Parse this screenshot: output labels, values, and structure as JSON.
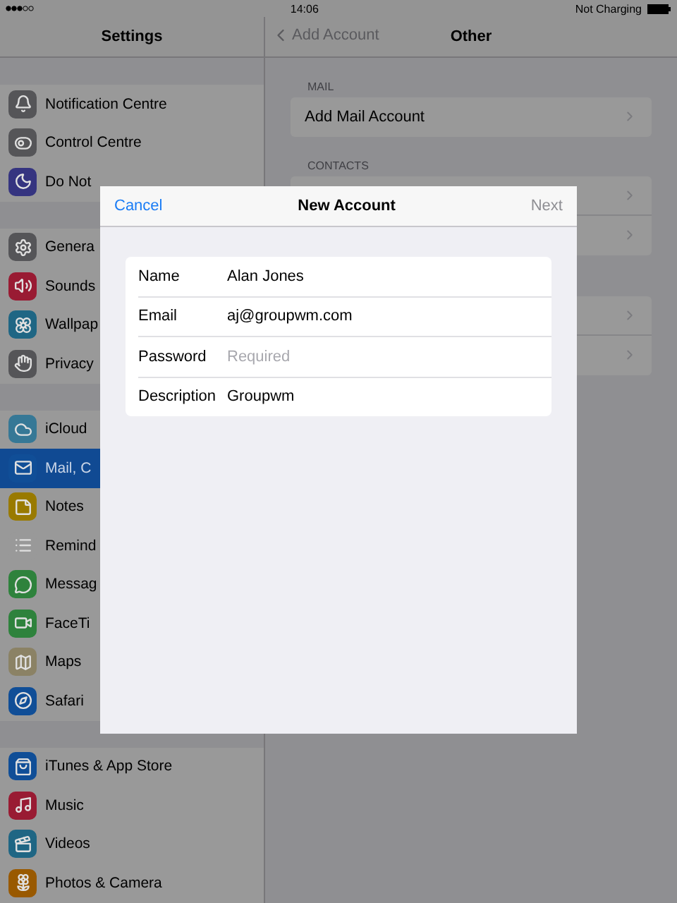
{
  "status_bar": {
    "time": "14:06",
    "charging": "Not Charging"
  },
  "sidebar": {
    "title": "Settings",
    "groups": [
      {
        "items": [
          {
            "label": "Notification Centre",
            "color": "#555558",
            "selected": false
          },
          {
            "label": "Control Centre",
            "color": "#555558",
            "selected": false
          },
          {
            "label": "Do Not",
            "color": "#353480",
            "selected": false
          }
        ]
      },
      {
        "items": [
          {
            "label": "Genera",
            "color": "#555558",
            "selected": false
          },
          {
            "label": "Sounds",
            "color": "#991b33",
            "selected": false
          },
          {
            "label": "Wallpap",
            "color": "#1f6684",
            "selected": false
          },
          {
            "label": "Privacy",
            "color": "#555558",
            "selected": false
          }
        ]
      },
      {
        "items": [
          {
            "label": "iCloud",
            "color": "#367896",
            "selected": false
          },
          {
            "label": "Mail, C",
            "color": "#104e97",
            "selected": true
          },
          {
            "label": "Notes",
            "color": "#997a00",
            "selected": false
          },
          {
            "label": "Remind",
            "color": "#999999",
            "selected": false
          },
          {
            "label": "Messag",
            "color": "#2e823c",
            "selected": false
          },
          {
            "label": "FaceTi",
            "color": "#2e823c",
            "selected": false
          },
          {
            "label": "Maps",
            "color": "#8b8265",
            "selected": false
          },
          {
            "label": "Safari",
            "color": "#104e97",
            "selected": false
          }
        ]
      },
      {
        "items": [
          {
            "label": "iTunes & App Store",
            "color": "#104e97",
            "selected": false
          },
          {
            "label": "Music",
            "color": "#991b33",
            "selected": false
          },
          {
            "label": "Videos",
            "color": "#1f6684",
            "selected": false
          },
          {
            "label": "Photos & Camera",
            "color": "#995900",
            "selected": false
          }
        ]
      }
    ]
  },
  "detail": {
    "back": "Add Account",
    "title": "Other",
    "sections": [
      {
        "header": "MAIL",
        "rows": [
          {
            "label": "Add Mail Account"
          }
        ]
      },
      {
        "header": "CONTACTS",
        "rows": [
          {},
          {}
        ]
      },
      {
        "rows": [
          {},
          {}
        ]
      }
    ]
  },
  "dialog": {
    "cancel": "Cancel",
    "title": "New Account",
    "next": {
      "label": "Next",
      "disabled": true
    },
    "fields": [
      {
        "label": "Name",
        "value": "Alan Jones"
      },
      {
        "label": "Email",
        "value": "aj@groupwm.com"
      },
      {
        "label": "Password",
        "placeholder": "Required"
      },
      {
        "label": "Description",
        "value": "Groupwm"
      }
    ]
  }
}
